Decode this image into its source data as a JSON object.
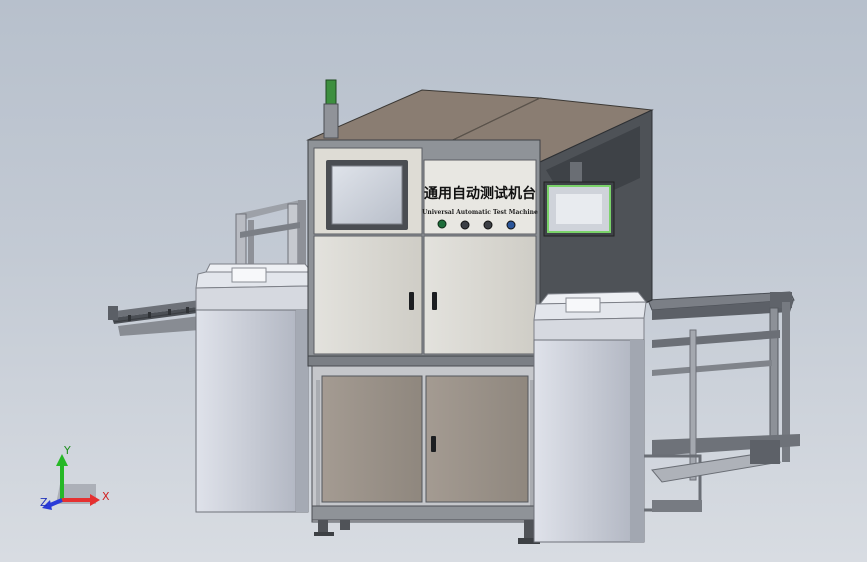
{
  "machine": {
    "title_cn": "通用自动测试机台",
    "title_en": "Universal Automatic Test Machine"
  },
  "triad": {
    "x_label": "X",
    "y_label": "Y",
    "z_label": "Z",
    "colors": {
      "x": "#e53030",
      "y": "#26b826",
      "z": "#2a3ad8"
    }
  },
  "colors": {
    "background_top": "#b7c0cc",
    "background_bottom": "#d8dce2",
    "cabinet_frame": "#8f9398",
    "cabinet_panel": "#d8d6d0",
    "roof": "#8a7d72",
    "side_panel": "#4e5257",
    "lower_door": "#9b9288",
    "screen": "#c7ccd6",
    "screen_border_green": "#7bd36a",
    "signal_lamp": "#3d8f3f"
  }
}
